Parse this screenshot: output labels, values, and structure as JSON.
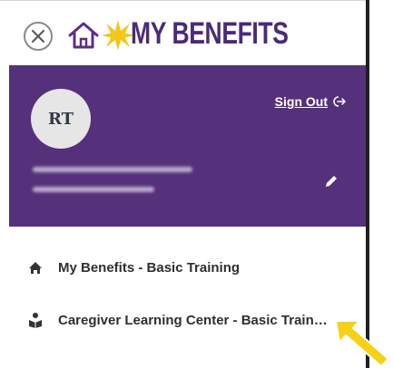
{
  "header": {
    "title": "MY BENEFITS",
    "close_icon": "close-icon",
    "home_icon": "home-icon",
    "sun_icon": "sun-icon"
  },
  "profile": {
    "initials": "RT",
    "sign_out_label": "Sign Out",
    "sign_out_icon": "sign-out-icon",
    "edit_icon": "pencil-icon"
  },
  "menu": {
    "items": [
      {
        "label": "My Benefits - Basic Training",
        "icon": "home-icon"
      },
      {
        "label": "Caregiver Learning Center - Basic Training",
        "icon": "caregiver-icon"
      }
    ]
  },
  "colors": {
    "brand_purple": "#55317c",
    "title_purple": "#4b2a7a",
    "sun_yellow": "#f5c518",
    "pointer_yellow": "#f7d117"
  }
}
